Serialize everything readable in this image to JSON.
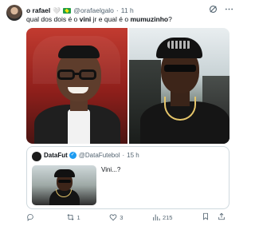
{
  "author": {
    "name": "o rafael",
    "emoji": "🤍",
    "handle": "@orafaelgalo",
    "dot": "·",
    "time": "11 h"
  },
  "tweet": {
    "text_1": "qual dos dois é o ",
    "bold_1": "vini",
    "text_2": " jr e qual é o ",
    "bold_2": "mumuzinho",
    "text_3": "?"
  },
  "quoted": {
    "name": "DataFut",
    "handle": "@DataFutebol",
    "dot": "·",
    "time": "15 h",
    "text": "Vini...?"
  },
  "actions": {
    "reply_count": "",
    "retweet_count": "1",
    "like_count": "3",
    "views_count": "215"
  },
  "icons": {
    "grok": "grok-icon",
    "more": "more-icon",
    "reply": "reply-icon",
    "retweet": "retweet-icon",
    "like": "heart-icon",
    "views": "views-icon",
    "bookmark": "bookmark-icon",
    "share": "share-icon"
  },
  "colors": {
    "text": "#0f1419",
    "muted": "#536471",
    "verified": "#1d9bf0",
    "border": "#cfd9de"
  }
}
